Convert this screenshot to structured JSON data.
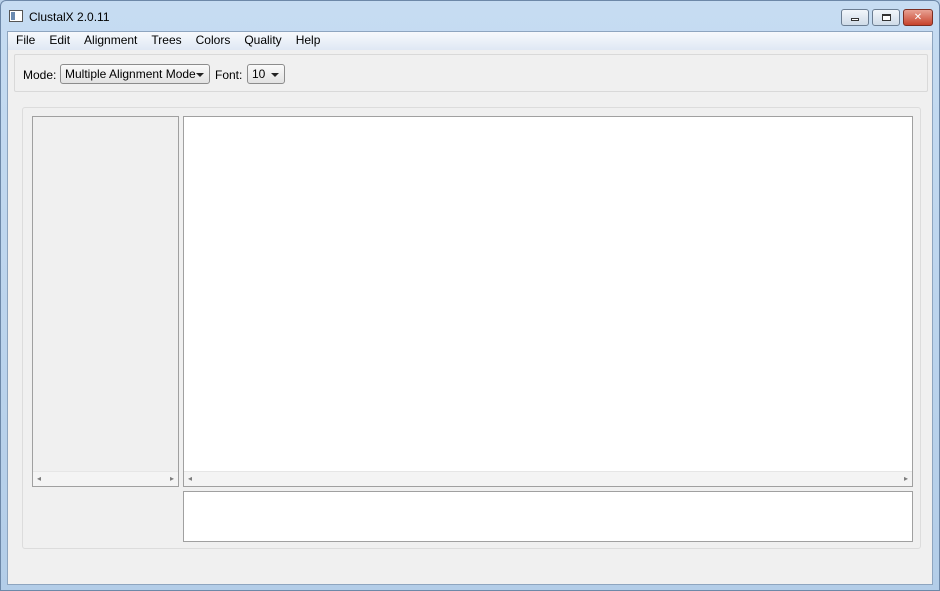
{
  "window": {
    "title": "ClustalX 2.0.11",
    "controls": {
      "minimize": "minimize-icon",
      "maximize": "maximize-icon",
      "close_glyph": "✕"
    }
  },
  "menu": {
    "items": [
      "File",
      "Edit",
      "Alignment",
      "Trees",
      "Colors",
      "Quality",
      "Help"
    ]
  },
  "toolbar": {
    "mode_label": "Mode:",
    "mode_value": "Multiple Alignment Mode",
    "font_label": "Font:",
    "font_value": "10"
  },
  "scroll": {
    "left_arrow": "◂",
    "right_arrow": "▸"
  },
  "colors": {
    "title_bar": "#c6dcf2",
    "client_bg": "#f0f0f0",
    "pane_bg": "#ffffff",
    "close_button": "#c7432c"
  }
}
